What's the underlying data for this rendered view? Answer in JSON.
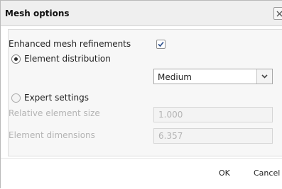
{
  "dialog": {
    "title": "Mesh options",
    "close_icon": "close-icon"
  },
  "options": {
    "enhanced_refinements": {
      "label": "Enhanced mesh refinements",
      "checked": true
    },
    "element_distribution": {
      "label": "Element distribution",
      "selected": true
    },
    "distribution_select": {
      "value": "Medium"
    },
    "expert_settings": {
      "label": "Expert settings",
      "selected": false
    },
    "relative_element_size": {
      "label": "Relative element size",
      "value": "1.000",
      "disabled": true
    },
    "element_dimensions": {
      "label": "Element dimensions",
      "value": "6.357",
      "disabled": true
    }
  },
  "footer": {
    "ok_label": "OK",
    "cancel_label": "Cancel"
  },
  "colors": {
    "titlebar_bg": "#efefef",
    "group_bg": "#f7f7f7",
    "disabled_text": "#b4b4b4"
  }
}
